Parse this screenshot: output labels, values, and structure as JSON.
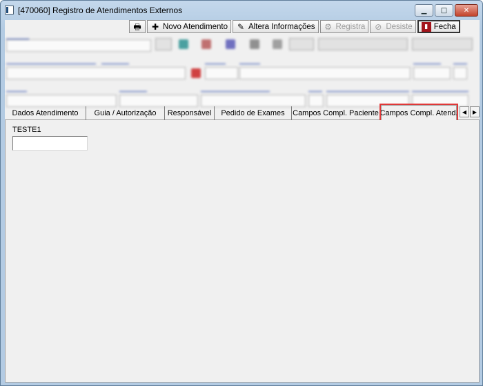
{
  "window": {
    "title": "[470060]  Registro de Atendimentos Externos"
  },
  "toolbar": {
    "novo_atendimento": "Novo Atendimento",
    "altera_informacoes": "Altera Informações",
    "registra": "Registra",
    "desiste": "Desiste",
    "fecha": "Fecha"
  },
  "tabs": [
    {
      "label": "Dados Atendimento",
      "active": false
    },
    {
      "label": "Guia / Autorização",
      "active": false
    },
    {
      "label": "Responsável",
      "active": false
    },
    {
      "label": "Pedido de Exames",
      "active": false
    },
    {
      "label": "Campos Compl. Paciente",
      "active": false
    },
    {
      "label": "Campos Compl. Atend.",
      "active": true
    }
  ],
  "panel": {
    "field_label": "TESTE1",
    "field_value": ""
  },
  "colors": {
    "highlight": "#e03838"
  }
}
